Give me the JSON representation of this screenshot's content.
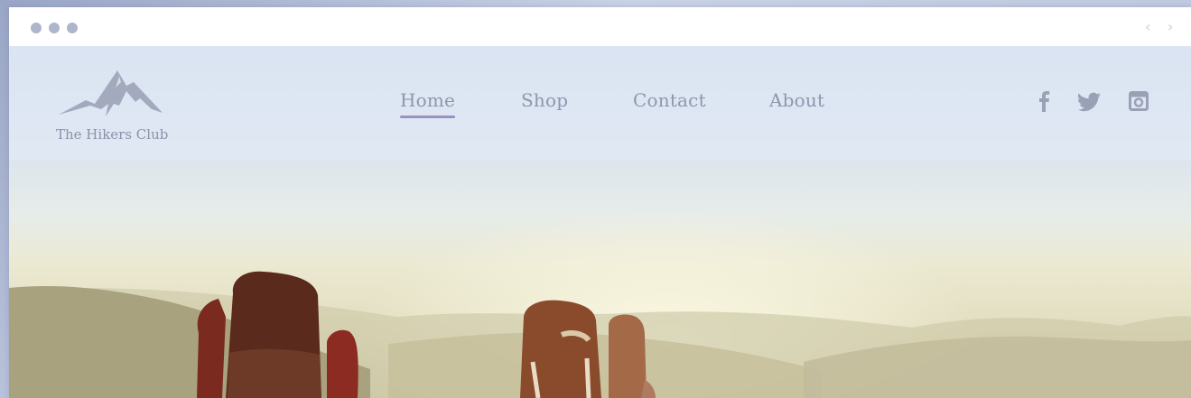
{
  "window": {
    "traffic_lights": [
      "window-dot-1",
      "window-dot-2",
      "window-dot-3"
    ],
    "back_glyph": "‹",
    "forward_glyph": "›"
  },
  "site": {
    "logo_text": "The Hikers Club",
    "logo_icon": "mountain-icon"
  },
  "nav": {
    "items": [
      {
        "label": "Home",
        "active": true
      },
      {
        "label": "Shop",
        "active": false
      },
      {
        "label": "Contact",
        "active": false
      },
      {
        "label": "About",
        "active": false
      }
    ]
  },
  "social": {
    "icons": [
      "facebook-icon",
      "twitter-icon",
      "instagram-icon"
    ]
  },
  "colors": {
    "nav_text": "#8e97ae",
    "active_underline": "#9b8fc3",
    "window_dots": "#aeb6cb"
  },
  "hero": {
    "image": "hikers-with-backpacks-in-hills-photo"
  }
}
